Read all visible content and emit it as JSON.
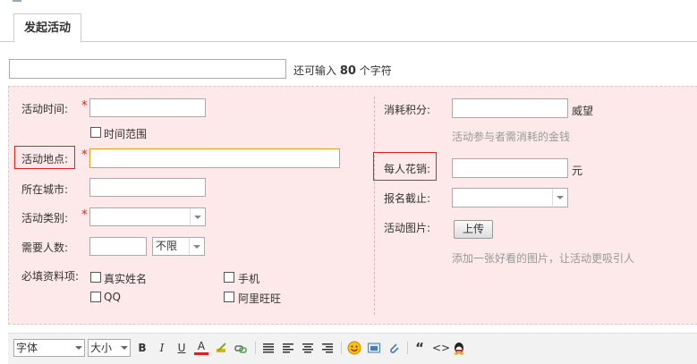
{
  "tab": {
    "label": "发起活动"
  },
  "title_hint": {
    "prefix": "还可输入 ",
    "count": "80",
    "suffix": " 个字符"
  },
  "left": {
    "time": {
      "label": "活动时间:",
      "range_label": "时间范围"
    },
    "place": {
      "label": "活动地点:"
    },
    "city": {
      "label": "所在城市:"
    },
    "category": {
      "label": "活动类别:"
    },
    "people": {
      "label": "需要人数:",
      "limit_value": "不限"
    },
    "required": {
      "label": "必填资料项:",
      "options": [
        "真实姓名",
        "手机",
        "QQ",
        "阿里旺旺"
      ]
    }
  },
  "right": {
    "credits": {
      "label": "消耗积分:",
      "unit": "威望",
      "hint": "活动参与者需消耗的金钱"
    },
    "cost": {
      "label": "每人花销:",
      "unit": "元"
    },
    "deadline": {
      "label": "报名截止:"
    },
    "image": {
      "label": "活动图片:",
      "button": "上传",
      "hint": "添加一张好看的图片，让活动更吸引人"
    }
  },
  "toolbar": {
    "font": "字体",
    "size": "大小",
    "bold": "B",
    "italic": "I",
    "underline": "U",
    "color": "A",
    "quote": "“",
    "code": "<>"
  },
  "colors": {
    "required": "#e02020",
    "highlight_box": "#dd2222",
    "form_bg": "#fde9e9"
  }
}
